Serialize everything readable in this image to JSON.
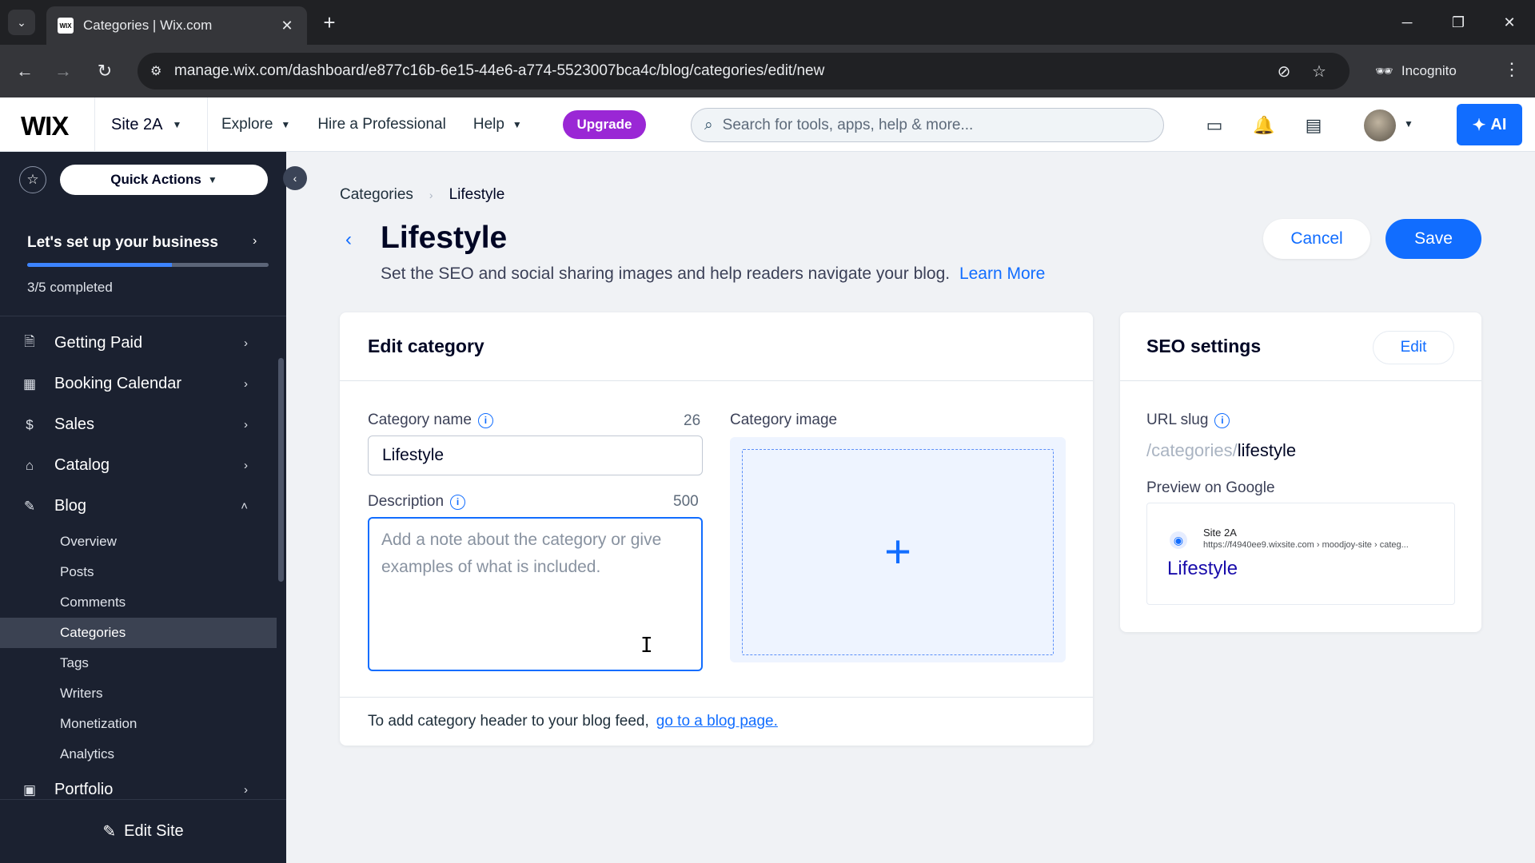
{
  "browser": {
    "tab_title": "Categories | Wix.com",
    "favicon_text": "WIX",
    "url": "manage.wix.com/dashboard/e877c16b-6e15-44e6-a774-5523007bca4c/blog/categories/edit/new",
    "incognito_label": "Incognito"
  },
  "topbar": {
    "logo": "WIX",
    "site_name": "Site 2A",
    "nav": [
      {
        "label": "Explore",
        "has_dropdown": true
      },
      {
        "label": "Hire a Professional",
        "has_dropdown": false
      },
      {
        "label": "Help",
        "has_dropdown": true
      }
    ],
    "upgrade_label": "Upgrade",
    "search_placeholder": "Search for tools, apps, help & more...",
    "ai_label": "AI",
    "icons": [
      "chat-icon",
      "bell-icon",
      "news-icon"
    ]
  },
  "sidebar": {
    "quick_actions_label": "Quick Actions",
    "setup": {
      "title": "Let's set up your business",
      "completed": "3/5 completed",
      "progress": 0.6
    },
    "menu": [
      {
        "label": "Getting Paid",
        "icon": "receipt-icon",
        "expanded": false
      },
      {
        "label": "Booking Calendar",
        "icon": "calendar-icon",
        "expanded": false
      },
      {
        "label": "Sales",
        "icon": "dollar-icon",
        "expanded": false
      },
      {
        "label": "Catalog",
        "icon": "tag-icon",
        "expanded": false
      },
      {
        "label": "Blog",
        "icon": "pen-nib-icon",
        "expanded": true
      }
    ],
    "blog_sub": [
      "Overview",
      "Posts",
      "Comments",
      "Categories",
      "Tags",
      "Writers",
      "Monetization",
      "Analytics"
    ],
    "active_sub": "Categories",
    "after_menu": {
      "label": "Portfolio",
      "icon": "portfolio-icon"
    },
    "edit_site_label": "Edit Site"
  },
  "page": {
    "breadcrumb": [
      "Categories",
      "Lifestyle"
    ],
    "title": "Lifestyle",
    "subtitle": "Set the SEO and social sharing images and help readers navigate your blog.",
    "learn_more": "Learn More",
    "cancel_label": "Cancel",
    "save_label": "Save"
  },
  "edit_category": {
    "title": "Edit category",
    "name_label": "Category name",
    "name_count": "26",
    "name_value": "Lifestyle",
    "desc_label": "Description",
    "desc_count": "500",
    "desc_placeholder": "Add a note about the category or give examples of what is included.",
    "image_label": "Category image",
    "footer_text": "To add category header to your blog feed,",
    "footer_link": "go to a blog page."
  },
  "seo": {
    "title": "SEO settings",
    "edit_label": "Edit",
    "slug_label": "URL slug",
    "slug_prefix": "/categories/",
    "slug_value": "lifestyle",
    "preview_label": "Preview on Google",
    "preview_site": "Site 2A",
    "preview_url": "https://f4940ee9.wixsite.com › moodjoy-site › categ...",
    "preview_title": "Lifestyle"
  }
}
